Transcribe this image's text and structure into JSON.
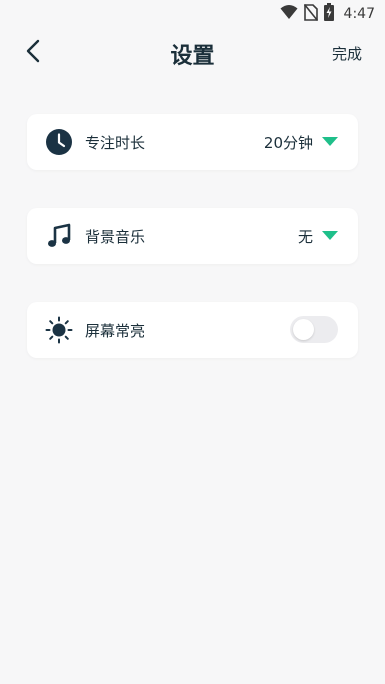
{
  "status_bar": {
    "time": "4:47",
    "icons": [
      "wifi-icon",
      "no-sim-icon",
      "battery-charging-icon"
    ]
  },
  "header": {
    "back_icon": "chevron-left-icon",
    "title": "设置",
    "done_label": "完成"
  },
  "settings": [
    {
      "id": "focus-duration",
      "icon": "clock-icon",
      "label": "专注时长",
      "value": "20分钟",
      "control": "dropdown"
    },
    {
      "id": "background-music",
      "icon": "music-note-icon",
      "label": "背景音乐",
      "value": "无",
      "control": "dropdown"
    },
    {
      "id": "keep-screen-on",
      "icon": "sun-icon",
      "label": "屏幕常亮",
      "control": "toggle",
      "toggle_on": false
    }
  ],
  "colors": {
    "accent": "#1fbf8a",
    "text": "#1b2f3a",
    "background": "#f7f7f8",
    "card": "#ffffff",
    "toggle_off": "#ececef"
  }
}
